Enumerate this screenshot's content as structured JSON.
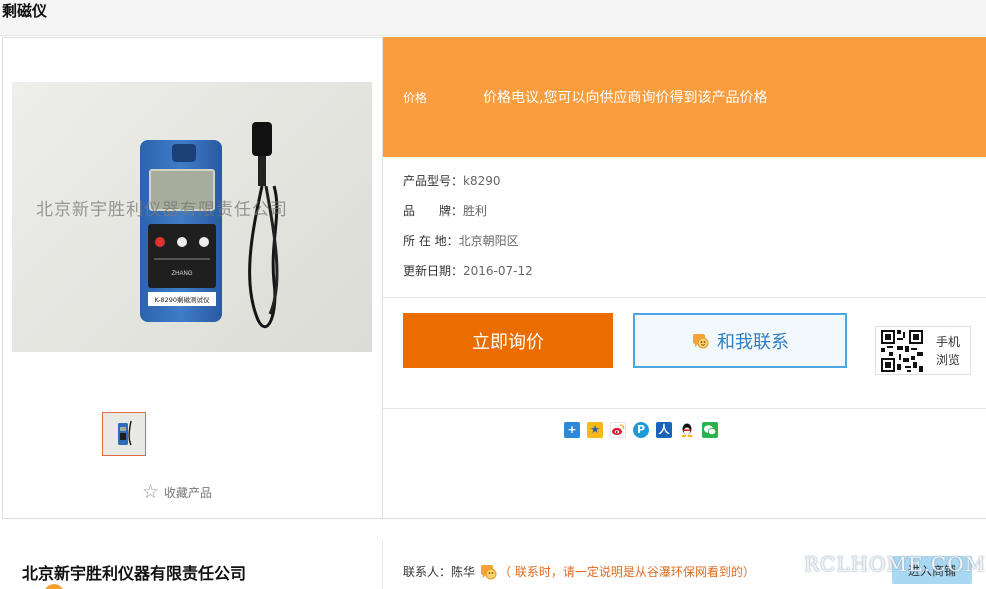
{
  "page": {
    "title": "剩磁仪"
  },
  "gallery": {
    "watermark": "北京新宇胜利仪器有限责任公司",
    "device_model_text": "K-8290剩磁测试仪",
    "favorite_label": "收藏产品"
  },
  "price": {
    "label": "价格",
    "text": "价格电议,您可以向供应商询价得到该产品价格"
  },
  "info": {
    "model": {
      "label": "产品型号：",
      "value": "k8290"
    },
    "brand": {
      "label": "品　　牌：",
      "value": "胜利"
    },
    "location": {
      "label": "所 在 地：",
      "value": "北京朝阳区"
    },
    "updated": {
      "label": "更新日期：",
      "value": "2016-07-12"
    }
  },
  "actions": {
    "inquiry_label": "立即询价",
    "contact_label": "和我联系",
    "qr_label": "手机浏览"
  },
  "share": {
    "icons": [
      "share-more-icon",
      "qzone-icon",
      "weibo-icon",
      "tencent-weibo-icon",
      "renren-icon",
      "qq-icon",
      "wechat-icon"
    ]
  },
  "supplier": {
    "company_name": "北京新宇胜利仪器有限责任公司",
    "contact_label": "联系人：",
    "contact_name": "陈华",
    "contact_note": "（ 联系时，请一定说明是从谷瀑环保网看到的）",
    "enter_shop_label": "进入商铺"
  },
  "watermark": {
    "site": "RCLHOME.COM"
  },
  "colors": {
    "accent_orange": "#eb6d00",
    "price_band": "#f99d3f",
    "link_blue": "#2f7fc4"
  }
}
